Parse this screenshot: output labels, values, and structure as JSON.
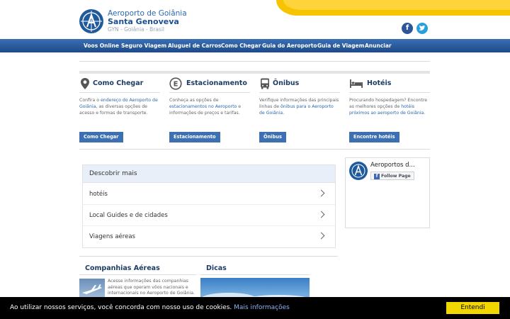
{
  "header": {
    "site_name": "Aeroporto de Goiânia",
    "site_subname": "Santa Genoveva",
    "location": "GYN - Goiânia - Brasil",
    "social": {
      "facebook": "f",
      "twitter": "t"
    }
  },
  "nav": {
    "items": [
      "Voos Online",
      "Seguro Viagem",
      "Aluguel de Carros",
      "Como Chegar",
      "Guia do Aeroporto",
      "Guia de Viagem",
      "Anunciar"
    ]
  },
  "columns": [
    {
      "title": "Como Chegar",
      "icon": "map-pin-icon",
      "text_before": "Confira o ",
      "link1": "endereço do Aeroporto de Goiânia",
      "text_after": ", as diversas opções de acesso e formas de transporte.",
      "link2": "",
      "text_end": "",
      "button": "Como Chegar"
    },
    {
      "title": "Estacionamento",
      "icon": "parking-icon",
      "text_before": "Conheça as opções de ",
      "link1": "estacionamentos no Aeroporto",
      "text_after": " e informações de preços e tarifas.",
      "link2": "",
      "text_end": "",
      "button": "Estacionamento"
    },
    {
      "title": "Ônibus",
      "icon": "bus-icon",
      "text_before": "Verifique informações das principais linhas de ",
      "link1": "ônibus para o Aeroporto de Goiânia",
      "text_after": ".",
      "link2": "",
      "text_end": "",
      "button": "Ônibus"
    },
    {
      "title": "Hotéis",
      "icon": "bed-icon",
      "text_before": "Procurando hospedagem? Encontre as melhores opções de ",
      "link1": "hotéis próximos ao aeroporto de Goiânia",
      "text_after": ".",
      "link2": "",
      "text_end": "",
      "button": "Encontre hotéis"
    }
  ],
  "discover": {
    "title": "Descobrir mais",
    "items": [
      "hotéis",
      "Local Guides e de cidades",
      "Viagens aéreas"
    ]
  },
  "facebook_box": {
    "name": "Aeroportos d...",
    "follow": "Follow Page",
    "follow_icon": "f"
  },
  "sections": {
    "airlines_title": "Companhias Aéreas",
    "airlines_text": "Acesse informações das companhias aéreas que operam vôos nacionais e internacionais no Aeroporto de Goiânia.",
    "tips_title": "Dicas"
  },
  "cookie": {
    "text": "Ao utilizar nossos serviços, você concorda com nosso uso de cookies. ",
    "more": "Mais informações",
    "button": "Entendi"
  },
  "colors": {
    "brand_blue": "#1f5a9c",
    "nav_blue": "#2a5c9e",
    "accent_yellow": "#f6c400",
    "cookie_button": "#f1d600"
  }
}
